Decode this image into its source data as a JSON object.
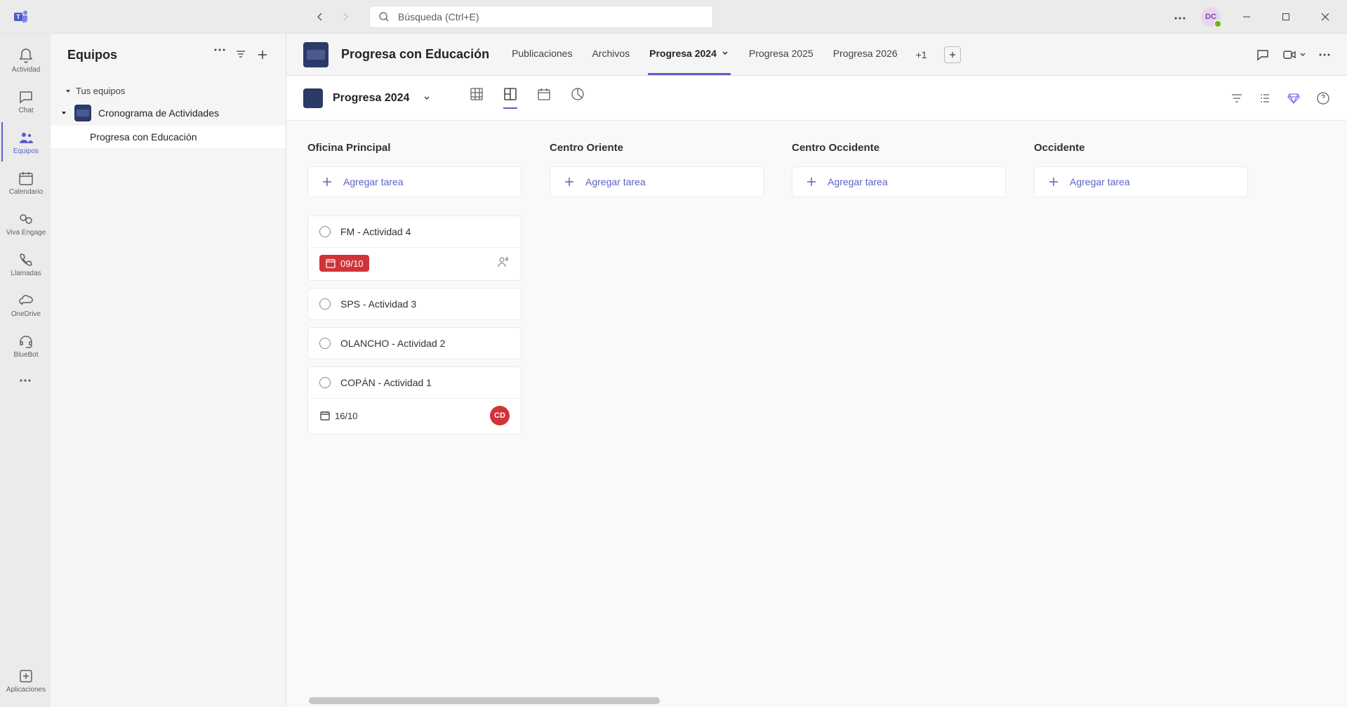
{
  "titlebar": {
    "search_placeholder": "Búsqueda (Ctrl+E)",
    "avatar_initials": "DC"
  },
  "rail": {
    "activity": "Actividad",
    "chat": "Chat",
    "teams": "Equipos",
    "calendar": "Calendario",
    "viva": "Viva Engage",
    "calls": "Llamadas",
    "onedrive": "OneDrive",
    "bluebot": "BlueBot",
    "apps": "Aplicaciones"
  },
  "panel": {
    "title": "Equipos",
    "section": "Tus equipos",
    "team_name": "Cronograma de Actividades",
    "channel_name": "Progresa con Educación"
  },
  "header": {
    "channel": "Progresa con Educación",
    "tabs": {
      "posts": "Publicaciones",
      "files": "Archivos",
      "p2024": "Progresa 2024",
      "p2025": "Progresa 2025",
      "p2026": "Progresa 2026",
      "more": "+1"
    }
  },
  "planner": {
    "plan_name": "Progresa 2024"
  },
  "board": {
    "add_task": "Agregar tarea",
    "buckets": [
      {
        "name": "Oficina Principal",
        "tasks": [
          {
            "title": "FM - Actividad 4",
            "date": "09/10",
            "overdue": true,
            "assignee_icon": true
          },
          {
            "title": "SPS - Actividad 3"
          },
          {
            "title": "OLANCHO - Actividad 2"
          },
          {
            "title": "COPÁN - Actividad 1",
            "date": "16/10",
            "assignee": "CD"
          }
        ]
      },
      {
        "name": "Centro Oriente",
        "tasks": []
      },
      {
        "name": "Centro Occidente",
        "tasks": []
      },
      {
        "name": "Occidente",
        "tasks": []
      }
    ]
  }
}
